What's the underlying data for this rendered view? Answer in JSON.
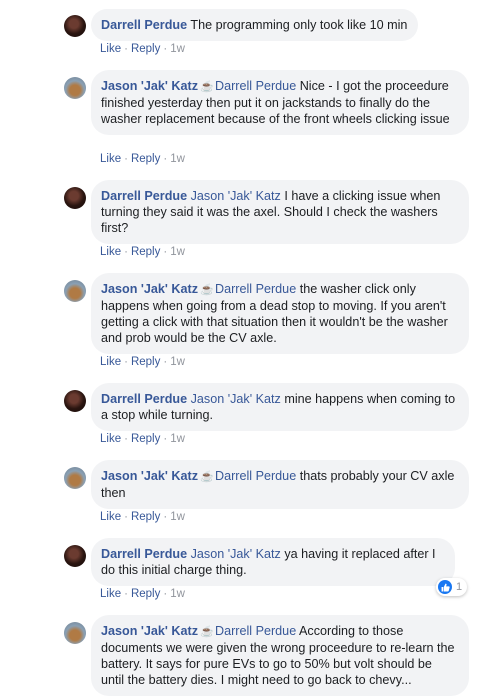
{
  "actions": {
    "like": "Like",
    "reply": "Reply",
    "separator": "·"
  },
  "colors": {
    "link": "#385898",
    "bubble": "#f2f3f5",
    "meta": "#90949c",
    "like_badge": "#1877f2"
  },
  "comments": [
    {
      "author": "Darrell Perdue",
      "mention": "",
      "text": "The programming only took like 10 min",
      "time": "1w",
      "avatar": "dark"
    },
    {
      "author": "Jason 'Jak' Katz",
      "author_icon": "coffee-cup-icon",
      "mention": "Darrell Perdue",
      "text": "Nice - I got the proceedure finished yesterday then put it on jackstands to finally do the washer replacement because of the front wheels clicking issue",
      "time": "1w",
      "avatar": "light"
    },
    {
      "author": "Darrell Perdue",
      "mention": "Jason 'Jak' Katz",
      "text": "I have a clicking issue when turning they said it was the axel. Should I check the washers first?",
      "time": "1w",
      "avatar": "dark"
    },
    {
      "author": "Jason 'Jak' Katz",
      "author_icon": "coffee-cup-icon",
      "mention": "Darrell Perdue",
      "text": "the washer click only happens when going from a dead stop to moving. If you aren't getting a click with that situation then it wouldn't be the washer and prob would be the CV axle.",
      "time": "1w",
      "avatar": "light"
    },
    {
      "author": "Darrell Perdue",
      "mention": "Jason 'Jak' Katz",
      "text": "mine happens when coming to a stop while turning.",
      "time": "1w",
      "avatar": "dark"
    },
    {
      "author": "Jason 'Jak' Katz",
      "author_icon": "coffee-cup-icon",
      "mention": "Darrell Perdue",
      "text": "thats probably your CV axle then",
      "time": "1w",
      "avatar": "light"
    },
    {
      "author": "Darrell Perdue",
      "mention": "Jason 'Jak' Katz",
      "text": "ya having it replaced after I do this initial charge thing.",
      "time": "1w",
      "avatar": "dark",
      "reaction_count": "1"
    },
    {
      "author": "Jason 'Jak' Katz",
      "author_icon": "coffee-cup-icon",
      "mention": "Darrell Perdue",
      "text": "According to those documents we were given the wrong proceedure to re-learn the battery. It says for pure EVs to go to 50% but volt should be until the battery dies. I might need to go back to chevy...",
      "time": "",
      "avatar": "light"
    }
  ]
}
